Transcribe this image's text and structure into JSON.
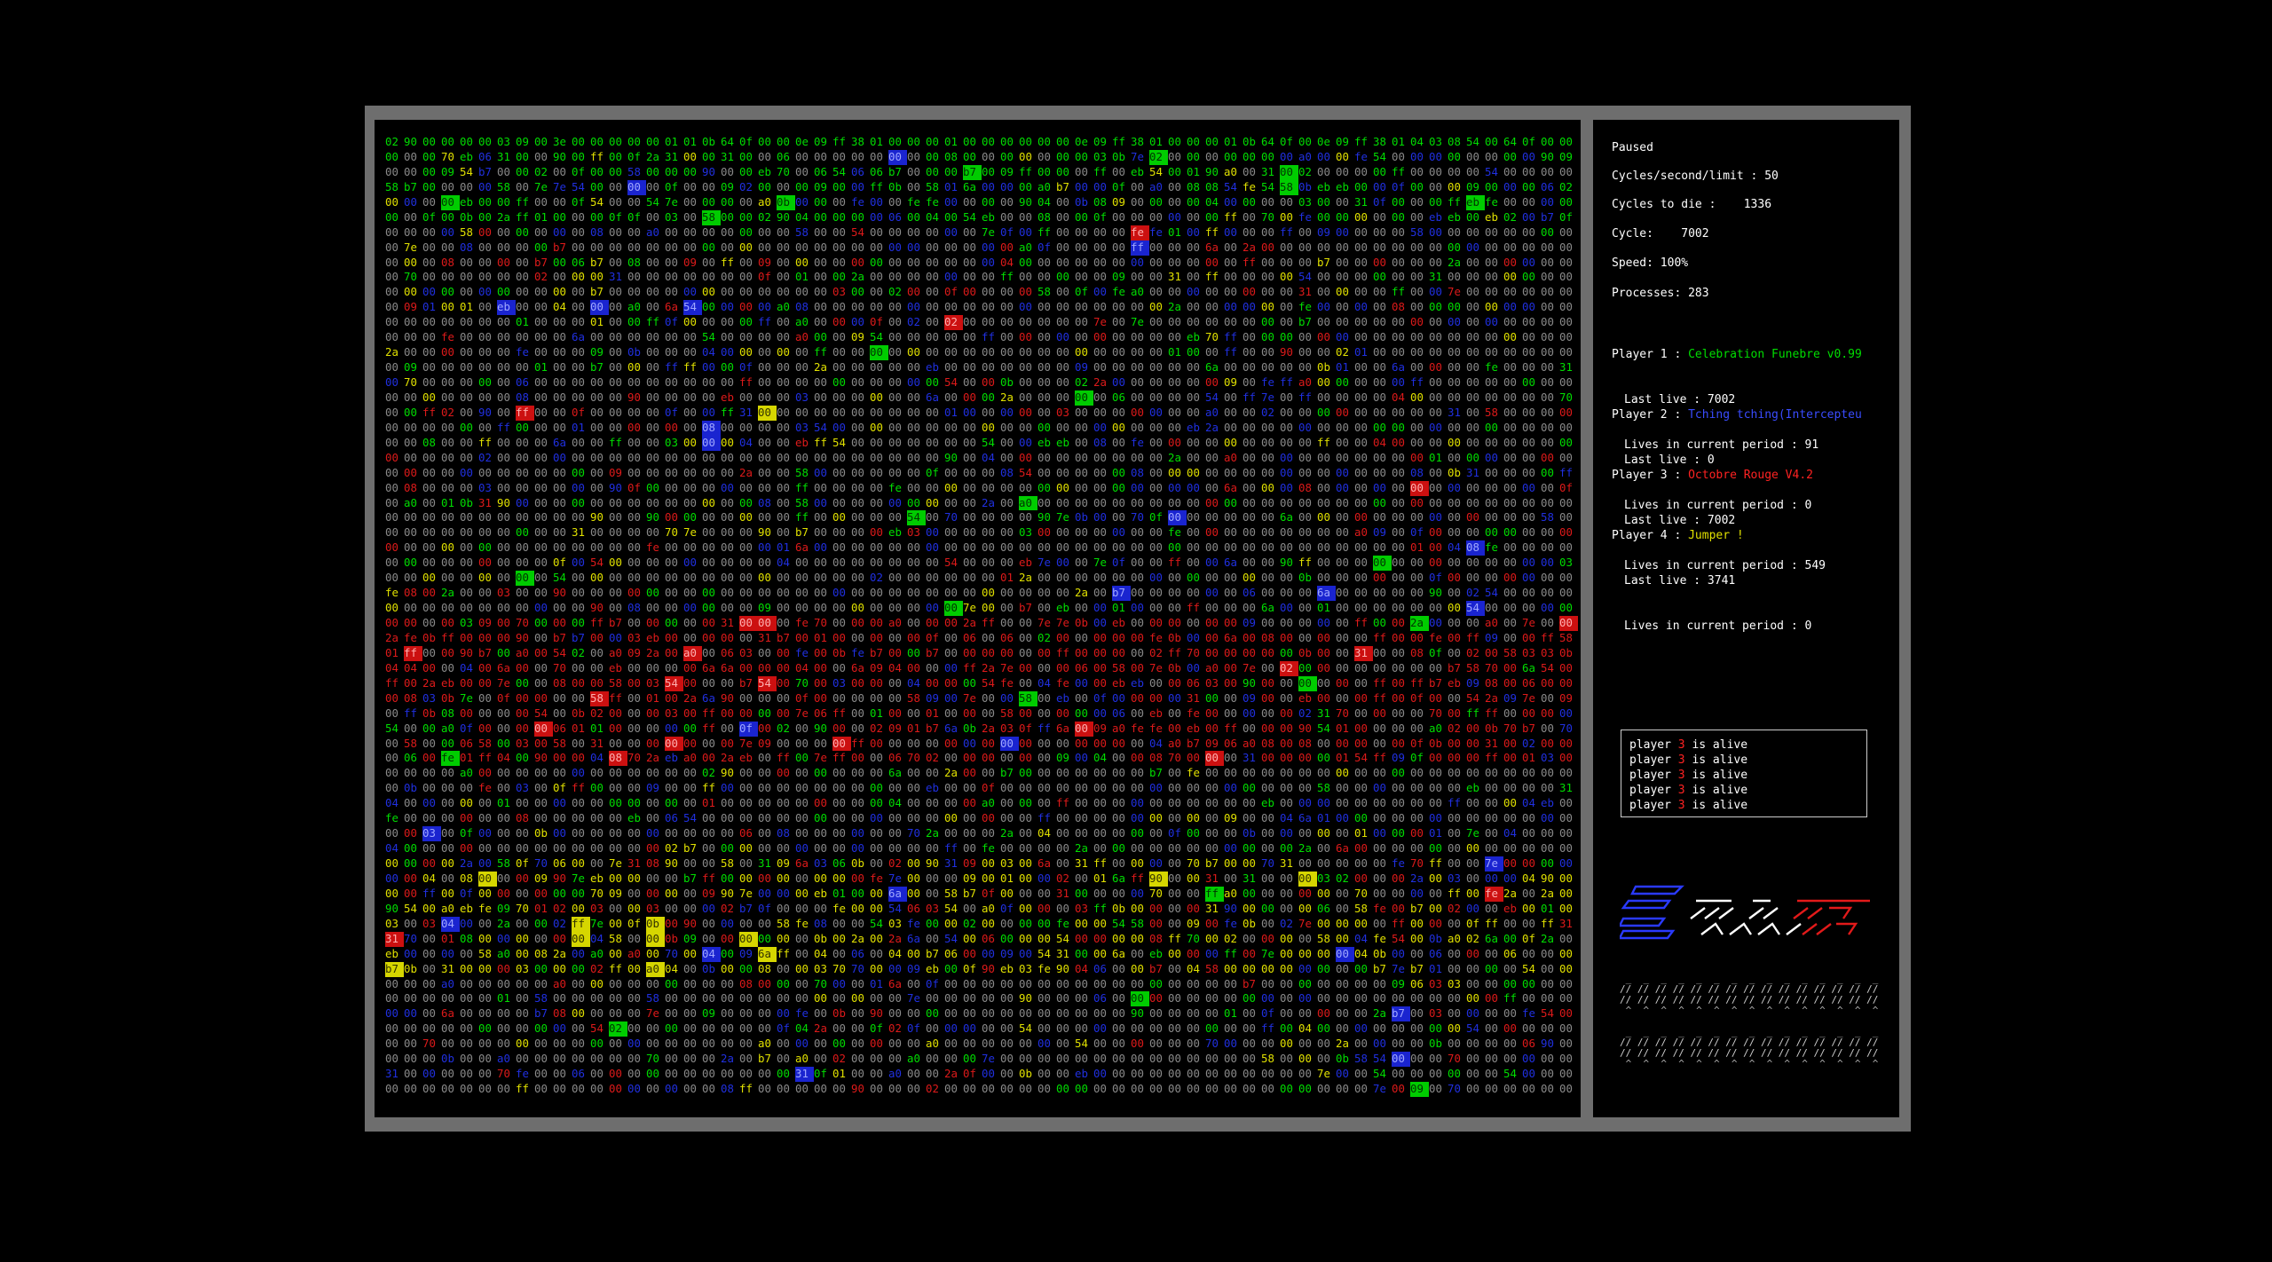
{
  "status": "Paused",
  "stats": {
    "cycles_per_second_label": "Cycles/second/limit :",
    "cycles_per_second_value": "50",
    "cycles_to_die_label": "Cycles to die :",
    "cycles_to_die_value": "1336",
    "cycle_label": "Cycle:",
    "cycle_value": "7002",
    "speed_label": "Speed:",
    "speed_value": "100%",
    "processes_label": "Processes:",
    "processes_value": "283"
  },
  "players": [
    {
      "label": "Player 1 :",
      "name": "Celebration Funebre v0.99",
      "last_live_label": "Last live :",
      "last_live": "7002",
      "lives_label": "Lives in current period :",
      "lives": "91",
      "color": "#00dd00"
    },
    {
      "label": "Player 2 :",
      "name": "Tching tching(Intercepteu",
      "last_live_label": "Last live :",
      "last_live": "0",
      "lives_label": "Lives in current period :",
      "lives": "0",
      "color": "#3a4cff"
    },
    {
      "label": "Player 3 :",
      "name": "Octobre Rouge V4.2",
      "last_live_label": "Last live :",
      "last_live": "7002",
      "lives_label": "Lives in current period :",
      "lives": "549",
      "color": "#ff2222"
    },
    {
      "label": "Player 4 :",
      "name": "Jumper !",
      "last_live_label": "Last live :",
      "last_live": "3741",
      "lives_label": "Lives in current period :",
      "lives": "0",
      "color": "#e0e000"
    }
  ],
  "log": [
    {
      "prefix": "player ",
      "num": "3",
      "suffix": " is alive"
    },
    {
      "prefix": "player ",
      "num": "3",
      "suffix": " is alive"
    },
    {
      "prefix": "player ",
      "num": "3",
      "suffix": " is alive"
    },
    {
      "prefix": "player ",
      "num": "3",
      "suffix": " is alive"
    },
    {
      "prefix": "player ",
      "num": "3",
      "suffix": " is alive"
    }
  ],
  "arena": {
    "columns": 64,
    "rows": 64,
    "colors": {
      "neutral": "#8a8a8a",
      "p1": "#00dd00",
      "p2": "#2030e0",
      "p3": "#dd1a1a",
      "p4": "#e0e000"
    },
    "first_row_bytes": [
      "02",
      "90",
      "00",
      "00",
      "00",
      "00",
      "03",
      "09",
      "00",
      "3e",
      "00",
      "00",
      "00",
      "00",
      "00",
      "01",
      "01",
      "0b",
      "64",
      "0f",
      "00",
      "00",
      "0e",
      "09",
      "ff",
      "38",
      "01",
      "00",
      "00",
      "00",
      "01",
      "00",
      "00",
      "00",
      "00",
      "00",
      "00",
      "0e",
      "09",
      "ff",
      "38",
      "01",
      "00",
      "00",
      "00",
      "01",
      "0b",
      "64",
      "0f",
      "00",
      "0e",
      "09",
      "ff",
      "38",
      "01",
      "04",
      "03",
      "08",
      "54",
      "00",
      "64",
      "0f",
      "00",
      "00"
    ]
  }
}
